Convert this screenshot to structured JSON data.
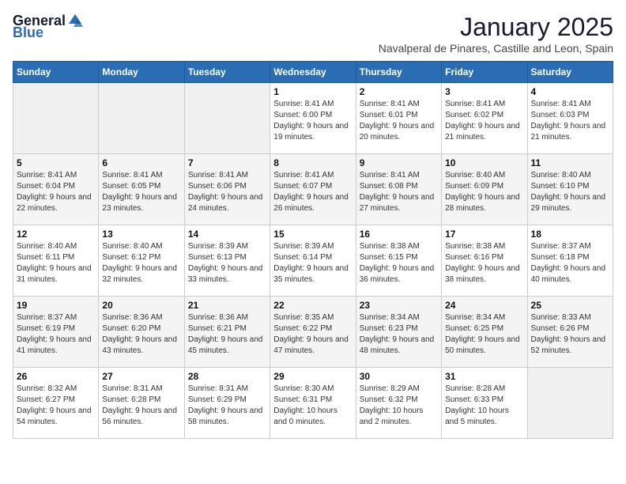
{
  "logo": {
    "general": "General",
    "blue": "Blue"
  },
  "title": "January 2025",
  "subtitle": "Navalperal de Pinares, Castille and Leon, Spain",
  "days_of_week": [
    "Sunday",
    "Monday",
    "Tuesday",
    "Wednesday",
    "Thursday",
    "Friday",
    "Saturday"
  ],
  "weeks": [
    [
      {
        "day": "",
        "empty": true
      },
      {
        "day": "",
        "empty": true
      },
      {
        "day": "",
        "empty": true
      },
      {
        "day": "1",
        "sunrise": "8:41 AM",
        "sunset": "6:00 PM",
        "daylight": "9 hours and 19 minutes."
      },
      {
        "day": "2",
        "sunrise": "8:41 AM",
        "sunset": "6:01 PM",
        "daylight": "9 hours and 20 minutes."
      },
      {
        "day": "3",
        "sunrise": "8:41 AM",
        "sunset": "6:02 PM",
        "daylight": "9 hours and 21 minutes."
      },
      {
        "day": "4",
        "sunrise": "8:41 AM",
        "sunset": "6:03 PM",
        "daylight": "9 hours and 21 minutes."
      }
    ],
    [
      {
        "day": "5",
        "sunrise": "8:41 AM",
        "sunset": "6:04 PM",
        "daylight": "9 hours and 22 minutes."
      },
      {
        "day": "6",
        "sunrise": "8:41 AM",
        "sunset": "6:05 PM",
        "daylight": "9 hours and 23 minutes."
      },
      {
        "day": "7",
        "sunrise": "8:41 AM",
        "sunset": "6:06 PM",
        "daylight": "9 hours and 24 minutes."
      },
      {
        "day": "8",
        "sunrise": "8:41 AM",
        "sunset": "6:07 PM",
        "daylight": "9 hours and 26 minutes."
      },
      {
        "day": "9",
        "sunrise": "8:41 AM",
        "sunset": "6:08 PM",
        "daylight": "9 hours and 27 minutes."
      },
      {
        "day": "10",
        "sunrise": "8:40 AM",
        "sunset": "6:09 PM",
        "daylight": "9 hours and 28 minutes."
      },
      {
        "day": "11",
        "sunrise": "8:40 AM",
        "sunset": "6:10 PM",
        "daylight": "9 hours and 29 minutes."
      }
    ],
    [
      {
        "day": "12",
        "sunrise": "8:40 AM",
        "sunset": "6:11 PM",
        "daylight": "9 hours and 31 minutes."
      },
      {
        "day": "13",
        "sunrise": "8:40 AM",
        "sunset": "6:12 PM",
        "daylight": "9 hours and 32 minutes."
      },
      {
        "day": "14",
        "sunrise": "8:39 AM",
        "sunset": "6:13 PM",
        "daylight": "9 hours and 33 minutes."
      },
      {
        "day": "15",
        "sunrise": "8:39 AM",
        "sunset": "6:14 PM",
        "daylight": "9 hours and 35 minutes."
      },
      {
        "day": "16",
        "sunrise": "8:38 AM",
        "sunset": "6:15 PM",
        "daylight": "9 hours and 36 minutes."
      },
      {
        "day": "17",
        "sunrise": "8:38 AM",
        "sunset": "6:16 PM",
        "daylight": "9 hours and 38 minutes."
      },
      {
        "day": "18",
        "sunrise": "8:37 AM",
        "sunset": "6:18 PM",
        "daylight": "9 hours and 40 minutes."
      }
    ],
    [
      {
        "day": "19",
        "sunrise": "8:37 AM",
        "sunset": "6:19 PM",
        "daylight": "9 hours and 41 minutes."
      },
      {
        "day": "20",
        "sunrise": "8:36 AM",
        "sunset": "6:20 PM",
        "daylight": "9 hours and 43 minutes."
      },
      {
        "day": "21",
        "sunrise": "8:36 AM",
        "sunset": "6:21 PM",
        "daylight": "9 hours and 45 minutes."
      },
      {
        "day": "22",
        "sunrise": "8:35 AM",
        "sunset": "6:22 PM",
        "daylight": "9 hours and 47 minutes."
      },
      {
        "day": "23",
        "sunrise": "8:34 AM",
        "sunset": "6:23 PM",
        "daylight": "9 hours and 48 minutes."
      },
      {
        "day": "24",
        "sunrise": "8:34 AM",
        "sunset": "6:25 PM",
        "daylight": "9 hours and 50 minutes."
      },
      {
        "day": "25",
        "sunrise": "8:33 AM",
        "sunset": "6:26 PM",
        "daylight": "9 hours and 52 minutes."
      }
    ],
    [
      {
        "day": "26",
        "sunrise": "8:32 AM",
        "sunset": "6:27 PM",
        "daylight": "9 hours and 54 minutes."
      },
      {
        "day": "27",
        "sunrise": "8:31 AM",
        "sunset": "6:28 PM",
        "daylight": "9 hours and 56 minutes."
      },
      {
        "day": "28",
        "sunrise": "8:31 AM",
        "sunset": "6:29 PM",
        "daylight": "9 hours and 58 minutes."
      },
      {
        "day": "29",
        "sunrise": "8:30 AM",
        "sunset": "6:31 PM",
        "daylight": "10 hours and 0 minutes."
      },
      {
        "day": "30",
        "sunrise": "8:29 AM",
        "sunset": "6:32 PM",
        "daylight": "10 hours and 2 minutes."
      },
      {
        "day": "31",
        "sunrise": "8:28 AM",
        "sunset": "6:33 PM",
        "daylight": "10 hours and 5 minutes."
      },
      {
        "day": "",
        "empty": true
      }
    ]
  ]
}
